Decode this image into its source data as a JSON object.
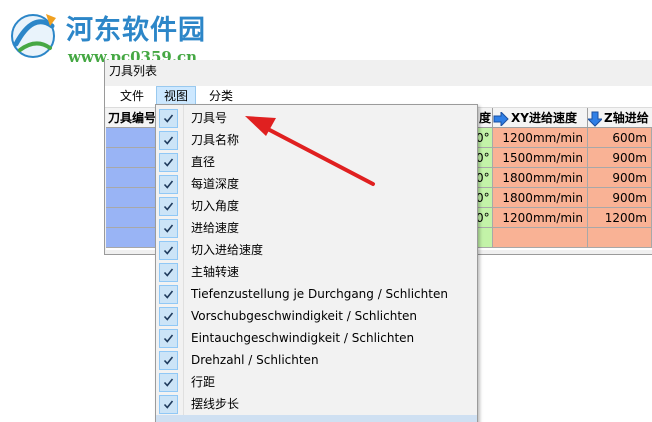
{
  "watermark": {
    "title": "河东软件园",
    "url": "www.pc0359.cn"
  },
  "window": {
    "title": "刀具列表"
  },
  "menu": {
    "file": "文件",
    "view": "视图",
    "category": "分类"
  },
  "table": {
    "headers": {
      "tool_number": "刀具编号",
      "angle_partial": "度",
      "xy_feed": "XY进给速度",
      "z_feed": "Z轴进给"
    },
    "rows": [
      {
        "angle": "0°",
        "xy_feed": "1200mm/min",
        "z_feed": "600m"
      },
      {
        "angle": "0°",
        "xy_feed": "1500mm/min",
        "z_feed": "900m"
      },
      {
        "angle": "0°",
        "xy_feed": "1800mm/min",
        "z_feed": "900m"
      },
      {
        "angle": "0°",
        "xy_feed": "1800mm/min",
        "z_feed": "900m"
      },
      {
        "angle": "0°",
        "xy_feed": "1200mm/min",
        "z_feed": "1200m"
      },
      {
        "angle": "",
        "xy_feed": "",
        "z_feed": ""
      }
    ]
  },
  "view_menu": {
    "items": [
      {
        "label": "刀具号",
        "checked": true
      },
      {
        "label": "刀具名称",
        "checked": true
      },
      {
        "label": "直径",
        "checked": true
      },
      {
        "label": "每道深度",
        "checked": true
      },
      {
        "label": "切入角度",
        "checked": true
      },
      {
        "label": "进给速度",
        "checked": true
      },
      {
        "label": "切入进给速度",
        "checked": true
      },
      {
        "label": "主轴转速",
        "checked": true
      },
      {
        "label": "Tiefenzustellung je Durchgang / Schlichten",
        "checked": true
      },
      {
        "label": "Vorschubgeschwindigkeit / Schlichten",
        "checked": true
      },
      {
        "label": "Eintauchgeschwindigkeit / Schlichten",
        "checked": true
      },
      {
        "label": "Drehzahl / Schlichten",
        "checked": true
      },
      {
        "label": "行距",
        "checked": true
      },
      {
        "label": "摆线步长",
        "checked": true
      }
    ]
  },
  "colors": {
    "tool_col": "#99b4f5",
    "angle_col": "#c3f3a8",
    "feed_col": "#f9b295",
    "arrow_icon": "#2f7fe6",
    "annotation_arrow": "#e02020",
    "watermark_blue": "#2c86c8",
    "watermark_green": "#46a844"
  }
}
